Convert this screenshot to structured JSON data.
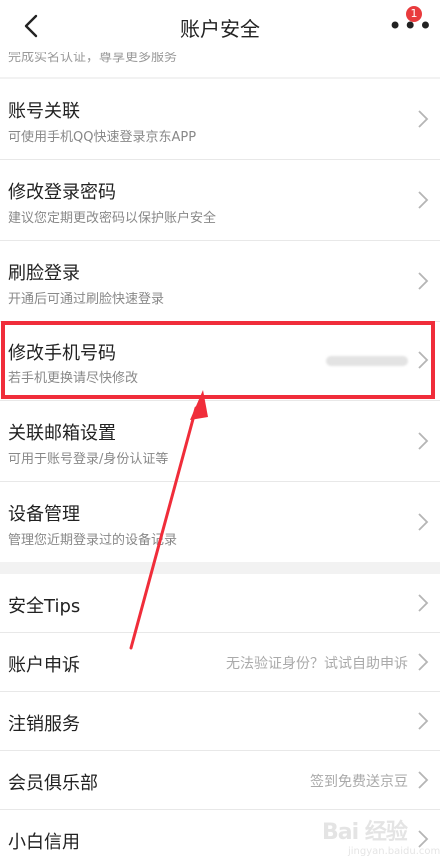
{
  "header": {
    "title": "账户安全",
    "badge_count": "1"
  },
  "partial_row": {
    "subtitle": "完成实名认证，尊享更多服务"
  },
  "rows": [
    {
      "title": "账号关联",
      "subtitle": "可使用手机QQ快速登录京东APP"
    },
    {
      "title": "修改登录密码",
      "subtitle": "建议您定期更改密码以保护账户安全"
    },
    {
      "title": "刷脸登录",
      "subtitle": "开通后可通过刷脸快速登录"
    },
    {
      "title": "修改手机号码",
      "subtitle": "若手机更换请尽快修改"
    },
    {
      "title": "关联邮箱设置",
      "subtitle": "可用于账号登录/身份认证等"
    },
    {
      "title": "设备管理",
      "subtitle": "管理您近期登录过的设备记录"
    }
  ],
  "rows2": [
    {
      "title": "安全Tips",
      "right": ""
    },
    {
      "title": "账户申诉",
      "right": "无法验证身份？试试自助申诉"
    },
    {
      "title": "注销服务",
      "right": ""
    },
    {
      "title": "会员俱乐部",
      "right": "签到免费送京豆"
    },
    {
      "title": "小白信用",
      "right": ""
    }
  ],
  "watermark": {
    "text": "Bai 经验",
    "sub": "jingyan.baidu.com"
  },
  "colors": {
    "highlight": "#f02d3a",
    "badge": "#e93b3d"
  },
  "icons": {
    "back": "chevron-left-icon",
    "more": "more-dots-icon",
    "row": "chevron-right-icon"
  }
}
